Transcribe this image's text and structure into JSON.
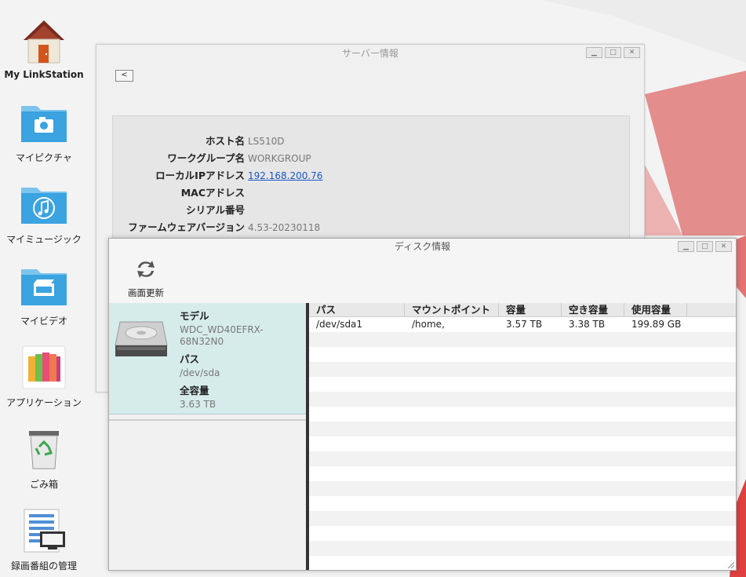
{
  "desktop": {
    "icons": [
      {
        "label": "My LinkStation",
        "icon": "house-icon"
      },
      {
        "label": "マイピクチャ",
        "icon": "camera-folder-icon"
      },
      {
        "label": "マイミュージック",
        "icon": "music-folder-icon"
      },
      {
        "label": "マイビデオ",
        "icon": "video-folder-icon"
      },
      {
        "label": "アプリケーション",
        "icon": "applications-icon"
      },
      {
        "label": "ごみ箱",
        "icon": "recycle-bin-icon"
      },
      {
        "label": "録画番組の管理",
        "icon": "recordings-icon"
      }
    ]
  },
  "server_window": {
    "title": "サーバー情報",
    "back_label": "<",
    "rows": [
      {
        "key": "ホスト名",
        "value": "LS510D"
      },
      {
        "key": "ワークグループ名",
        "value": "WORKGROUP"
      },
      {
        "key": "ローカルIPアドレス",
        "value": "192.168.200.76"
      },
      {
        "key": "MACアドレス",
        "value": ""
      },
      {
        "key": "シリアル番号",
        "value": ""
      },
      {
        "key": "ファームウェアバージョン",
        "value": "4.53-20230118"
      }
    ]
  },
  "disk_window": {
    "title": "ディスク情報",
    "refresh_label": "画面更新",
    "disk": {
      "model_label": "モデル",
      "model_line1": "WDC_WD40EFRX-",
      "model_line2": "68N32N0",
      "path_label": "パス",
      "path_value": "/dev/sda",
      "capacity_label": "全容量",
      "capacity_value": "3.63 TB"
    },
    "columns": [
      "パス",
      "マウントポイント",
      "容量",
      "空き容量",
      "使用容量"
    ],
    "rows": [
      [
        "/dev/sda1",
        "/home,",
        "3.57 TB",
        "3.38 TB",
        "199.89 GB"
      ]
    ]
  },
  "colors": {
    "accent_red": "#e06666",
    "selection_bg": "#d6eceb",
    "link": "#1a55c8"
  }
}
